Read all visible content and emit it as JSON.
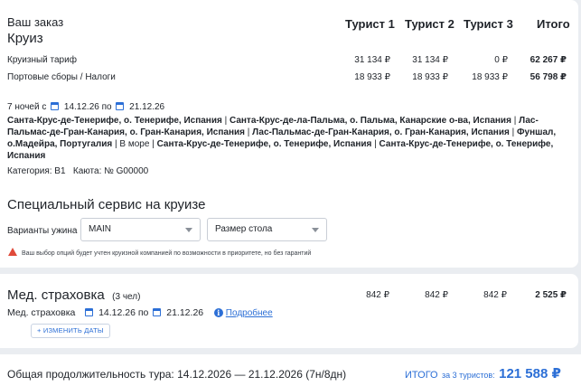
{
  "order": {
    "heading": "Ваш заказ",
    "product": "Круиз",
    "columns": [
      "Турист 1",
      "Турист 2",
      "Турист 3",
      "Итого"
    ],
    "rows": [
      {
        "label": "Круизный тариф",
        "values": [
          "31 134 ₽",
          "31 134 ₽",
          "0 ₽"
        ],
        "total": "62 267 ₽"
      },
      {
        "label": "Портовые сборы / Налоги",
        "values": [
          "18 933 ₽",
          "18 933 ₽",
          "18 933 ₽"
        ],
        "total": "56 798 ₽"
      }
    ],
    "dates": {
      "nights": "7 ночей с",
      "from": "14.12.26",
      "to_word": "по",
      "to": "21.12.26"
    },
    "route_parts": [
      "Санта-Крус-де-Тенерифе, о. Тенерифе, Испания",
      " | ",
      "Санта-Крус-де-ла-Пальма, о. Пальма, Канарские о-ва, Испания",
      " | ",
      "Лас-Пальмас-де-Гран-Канария, о. Гран-Канария, Испания",
      " | ",
      "Лас-Пальмас-де-Гран-Канария, о. Гран-Канария, Испания",
      " | ",
      "Фуншал, о.Мадейра, Португалия",
      " | В море | ",
      "Санта-Крус-де-Тенерифе, о. Тенерифе, Испания",
      " | ",
      "Санта-Крус-де-Тенерифе, о. Тенерифе, Испания"
    ],
    "category": "Категория: B1",
    "cabin": "Каюта: № G00000"
  },
  "service": {
    "title": "Специальный сервис на круизе",
    "dinner_label": "Варианты ужина",
    "dinner_value": "MAIN",
    "table_value": "Размер стола",
    "warning": "Ваш выбор опций будет учтен круизной компанией по возможности в приоритете, но без гарантий"
  },
  "insurance": {
    "title": "Мед. страховка",
    "count": "(3 чел)",
    "values": [
      "842 ₽",
      "842 ₽",
      "842 ₽"
    ],
    "total": "2 525 ₽",
    "row_label": "Мед. страховка",
    "from": "14.12.26",
    "to_word": "по",
    "to": "21.12.26",
    "more_link": "Подробнее",
    "change_dates": "+ ИЗМЕНИТЬ ДАТЫ"
  },
  "footer": {
    "duration": "Общая продолжительность тура: 14.12.2026 — 21.12.2026 (7н/8дн)",
    "total_label": "ИТОГО",
    "total_for": "за 3 туристов:",
    "total_value": "121 588 ₽"
  },
  "colors": {
    "accent": "#2c6fd6",
    "warning": "#e04a3a",
    "background": "#eaedf1"
  },
  "icons": [
    "calendar-icon",
    "warning-icon",
    "info-icon",
    "chevron-down-icon"
  ]
}
